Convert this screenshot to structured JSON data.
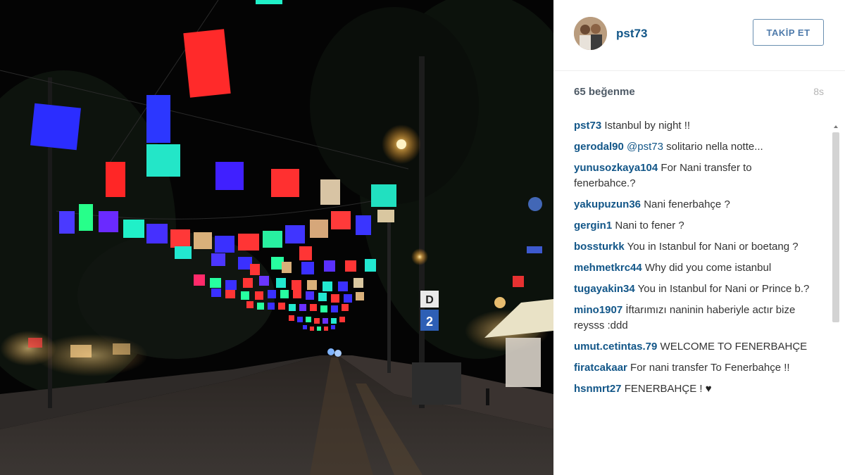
{
  "post": {
    "username": "pst73",
    "follow_label": "TAKİP ET",
    "likes": "65 beğenme",
    "time": "8s"
  },
  "comments": [
    {
      "user": "pst73",
      "text": " Istanbul by night !!"
    },
    {
      "user": "gerodal90",
      "mention": " @pst73",
      "text": " solitario nella notte..."
    },
    {
      "user": "yunusozkaya104",
      "text": " For Nani transfer to fenerbahce.?"
    },
    {
      "user": "yakupuzun36",
      "text": " Nani fenerbahçe ?"
    },
    {
      "user": "gergin1",
      "text": " Nani to fener ?"
    },
    {
      "user": "bossturkk",
      "text": " You in Istanbul for Nani or boetang ?"
    },
    {
      "user": "mehmetkrc44",
      "text": " Why did you come istanbul"
    },
    {
      "user": "tugayakin34",
      "text": " You in Istanbul for Nani or Prince b.?"
    },
    {
      "user": "mino1907",
      "text": " İftarımızı naninin haberiyle actır bize reysss :ddd"
    },
    {
      "user": "umut.cetintas.79",
      "text": " WELCOME TO FENERBAHÇE"
    },
    {
      "user": "firatcakaar",
      "text": " For nani transfer To Fenerbahçe !!"
    },
    {
      "user": "hsnmrt27",
      "text": " FENERBAHÇE ! ",
      "heart": "♥"
    }
  ],
  "photo": {
    "sign_top": "D",
    "sign_bottom": "2"
  }
}
